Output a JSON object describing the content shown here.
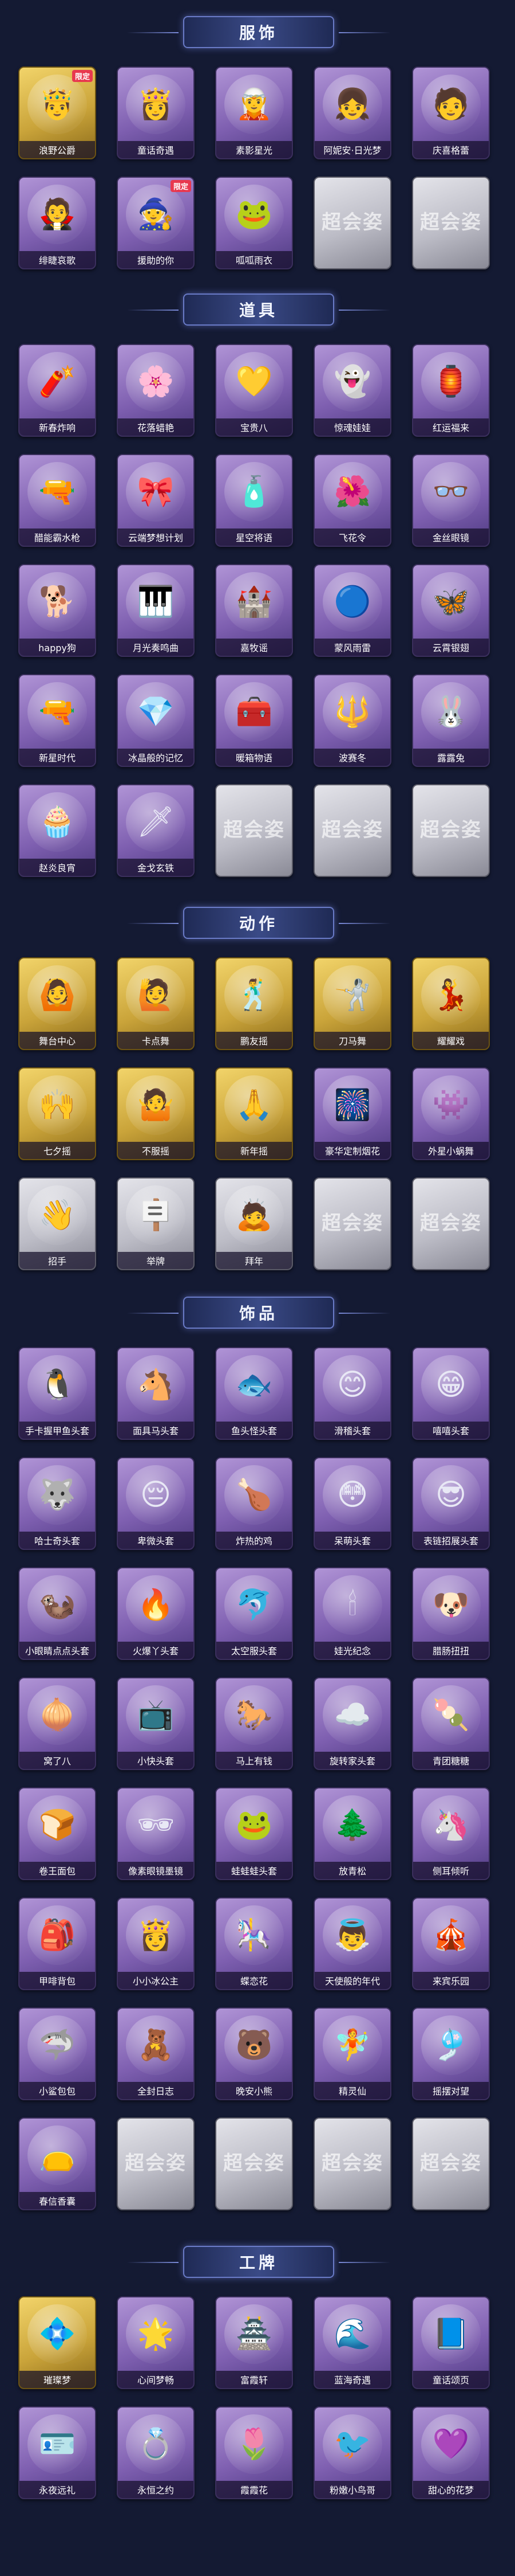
{
  "sections": [
    {
      "title": "服饰"
    },
    {
      "title": "道具"
    },
    {
      "title": "动作"
    },
    {
      "title": "饰品"
    },
    {
      "title": "工牌"
    }
  ],
  "placeholder_watermark": "超会姿",
  "badge_text": "限定",
  "items": {
    "s0": [
      {
        "label": "浪野公爵",
        "icon": "🤴",
        "style": "gold",
        "badge": "限定"
      },
      {
        "label": "童话奇遇",
        "icon": "👸",
        "style": "purple"
      },
      {
        "label": "素影星光",
        "icon": "🧝",
        "style": "purple"
      },
      {
        "label": "阿妮安·日光梦",
        "icon": "👧",
        "style": "purple"
      },
      {
        "label": "庆喜格蕾",
        "icon": "🧑",
        "style": "purple"
      },
      {
        "label": "绯睫哀歌",
        "icon": "🧛",
        "style": "purple"
      },
      {
        "label": "援助的你",
        "icon": "🧙",
        "style": "purple",
        "badge": "限定"
      },
      {
        "label": "呱呱雨衣",
        "icon": "🐸",
        "style": "purple"
      }
    ],
    "s1": [
      {
        "label": "新春炸响",
        "icon": "🧨",
        "style": "purple"
      },
      {
        "label": "花落蜡艳",
        "icon": "🌸",
        "style": "purple"
      },
      {
        "label": "宝贵八",
        "icon": "💛",
        "style": "purple"
      },
      {
        "label": "惊魂娃娃",
        "icon": "👻",
        "style": "purple"
      },
      {
        "label": "红运福来",
        "icon": "🏮",
        "style": "purple"
      },
      {
        "label": "醋能霸水枪",
        "icon": "🔫",
        "style": "purple"
      },
      {
        "label": "云端梦想计划",
        "icon": "🎀",
        "style": "purple"
      },
      {
        "label": "星空将语",
        "icon": "🧴",
        "style": "purple"
      },
      {
        "label": "飞花令",
        "icon": "🌺",
        "style": "purple"
      },
      {
        "label": "金丝眼镜",
        "icon": "👓",
        "style": "purple"
      },
      {
        "label": "happy狗",
        "icon": "🐕",
        "style": "purple"
      },
      {
        "label": "月光奏鸣曲",
        "icon": "🎹",
        "style": "purple"
      },
      {
        "label": "嘉牧谣",
        "icon": "🏰",
        "style": "purple"
      },
      {
        "label": "蒙风雨雷",
        "icon": "🔵",
        "style": "purple"
      },
      {
        "label": "云霄银翅",
        "icon": "🦋",
        "style": "purple"
      },
      {
        "label": "新星时代",
        "icon": "🔫",
        "style": "purple"
      },
      {
        "label": "冰晶般的记忆",
        "icon": "💎",
        "style": "purple"
      },
      {
        "label": "暖箱物语",
        "icon": "🧰",
        "style": "purple"
      },
      {
        "label": "波赛冬",
        "icon": "🔱",
        "style": "purple"
      },
      {
        "label": "露露兔",
        "icon": "🐰",
        "style": "purple"
      },
      {
        "label": "赵炎良宵",
        "icon": "🧁",
        "style": "purple"
      },
      {
        "label": "金戈玄铁",
        "icon": "🗡",
        "style": "purple"
      }
    ],
    "s2": [
      {
        "label": "舞台中心",
        "icon": "🙆",
        "style": "gold"
      },
      {
        "label": "卡点舞",
        "icon": "🙋",
        "style": "gold"
      },
      {
        "label": "鹏友摇",
        "icon": "🕺",
        "style": "gold"
      },
      {
        "label": "刀马舞",
        "icon": "🤺",
        "style": "gold"
      },
      {
        "label": "耀耀戏",
        "icon": "💃",
        "style": "gold"
      },
      {
        "label": "七夕摇",
        "icon": "🙌",
        "style": "gold"
      },
      {
        "label": "不服摇",
        "icon": "🤷",
        "style": "gold"
      },
      {
        "label": "新年摇",
        "icon": "🙏",
        "style": "gold"
      },
      {
        "label": "豪华定制烟花",
        "icon": "🎆",
        "style": "purple"
      },
      {
        "label": "外星小蜗舞",
        "icon": "👾",
        "style": "purple"
      },
      {
        "label": "招手",
        "icon": "👋",
        "style": "gray"
      },
      {
        "label": "举牌",
        "icon": "🪧",
        "style": "gray"
      },
      {
        "label": "拜年",
        "icon": "🙇",
        "style": "gray"
      }
    ],
    "s3": [
      {
        "label": "手卡握甲鱼头套",
        "icon": "🐧",
        "style": "purple"
      },
      {
        "label": "面具马头套",
        "icon": "🐴",
        "style": "purple"
      },
      {
        "label": "鱼头怪头套",
        "icon": "🐟",
        "style": "purple"
      },
      {
        "label": "滑稽头套",
        "icon": "😊",
        "style": "purple"
      },
      {
        "label": "嘻嘻头套",
        "icon": "😁",
        "style": "purple"
      },
      {
        "label": "哈士奇头套",
        "icon": "🐺",
        "style": "purple"
      },
      {
        "label": "卑微头套",
        "icon": "😔",
        "style": "purple"
      },
      {
        "label": "炸热的鸡",
        "icon": "🍗",
        "style": "purple"
      },
      {
        "label": "呆萌头套",
        "icon": "😳",
        "style": "purple"
      },
      {
        "label": "表链招展头套",
        "icon": "😎",
        "style": "purple"
      },
      {
        "label": "小眼睛点点头套",
        "icon": "🦦",
        "style": "purple"
      },
      {
        "label": "火爆丫头套",
        "icon": "🔥",
        "style": "purple"
      },
      {
        "label": "太空服头套",
        "icon": "🐬",
        "style": "purple"
      },
      {
        "label": "娃光纪念",
        "icon": "🕯",
        "style": "purple"
      },
      {
        "label": "腊肠扭扭",
        "icon": "🐶",
        "style": "purple"
      },
      {
        "label": "窝了八",
        "icon": "🧅",
        "style": "purple"
      },
      {
        "label": "小快头套",
        "icon": "📺",
        "style": "purple"
      },
      {
        "label": "马上有钱",
        "icon": "🐎",
        "style": "purple"
      },
      {
        "label": "旋转家头套",
        "icon": "☁️",
        "style": "purple"
      },
      {
        "label": "青团糖糖",
        "icon": "🍡",
        "style": "purple"
      },
      {
        "label": "卷王面包",
        "icon": "🍞",
        "style": "purple"
      },
      {
        "label": "像素眼镜墨镜",
        "icon": "🕶",
        "style": "purple"
      },
      {
        "label": "蛙蛙蛙头套",
        "icon": "🐸",
        "style": "purple"
      },
      {
        "label": "放青松",
        "icon": "🌲",
        "style": "purple"
      },
      {
        "label": "侧耳倾听",
        "icon": "🦄",
        "style": "purple"
      },
      {
        "label": "甲啡背包",
        "icon": "🎒",
        "style": "purple"
      },
      {
        "label": "小小冰公主",
        "icon": "👸",
        "style": "purple"
      },
      {
        "label": "蝶恋花",
        "icon": "🎠",
        "style": "purple"
      },
      {
        "label": "天使般的年代",
        "icon": "👼",
        "style": "purple"
      },
      {
        "label": "来宾乐园",
        "icon": "🎪",
        "style": "purple"
      },
      {
        "label": "小鲨包包",
        "icon": "🦈",
        "style": "purple"
      },
      {
        "label": "全封日志",
        "icon": "🧸",
        "style": "purple"
      },
      {
        "label": "晚安小熊",
        "icon": "🐻",
        "style": "purple"
      },
      {
        "label": "精灵仙",
        "icon": "🧚",
        "style": "purple"
      },
      {
        "label": "摇摆对望",
        "icon": "🎐",
        "style": "purple"
      },
      {
        "label": "春信香囊",
        "icon": "👝",
        "style": "purple"
      }
    ],
    "s4": [
      {
        "label": "璀璨梦",
        "icon": "💠",
        "style": "gold"
      },
      {
        "label": "心间梦畅",
        "icon": "🌟",
        "style": "purple"
      },
      {
        "label": "富霞轩",
        "icon": "🏯",
        "style": "purple"
      },
      {
        "label": "蓝海奇遇",
        "icon": "🌊",
        "style": "purple"
      },
      {
        "label": "童话颂页",
        "icon": "📘",
        "style": "purple"
      },
      {
        "label": "永夜远礼",
        "icon": "🪪",
        "style": "purple"
      },
      {
        "label": "永恒之约",
        "icon": "💍",
        "style": "purple"
      },
      {
        "label": "霞霞花",
        "icon": "🌷",
        "style": "purple"
      },
      {
        "label": "粉嫩小鸟哥",
        "icon": "🐦",
        "style": "purple"
      },
      {
        "label": "甜心的花梦",
        "icon": "💜",
        "style": "purple"
      }
    ]
  }
}
